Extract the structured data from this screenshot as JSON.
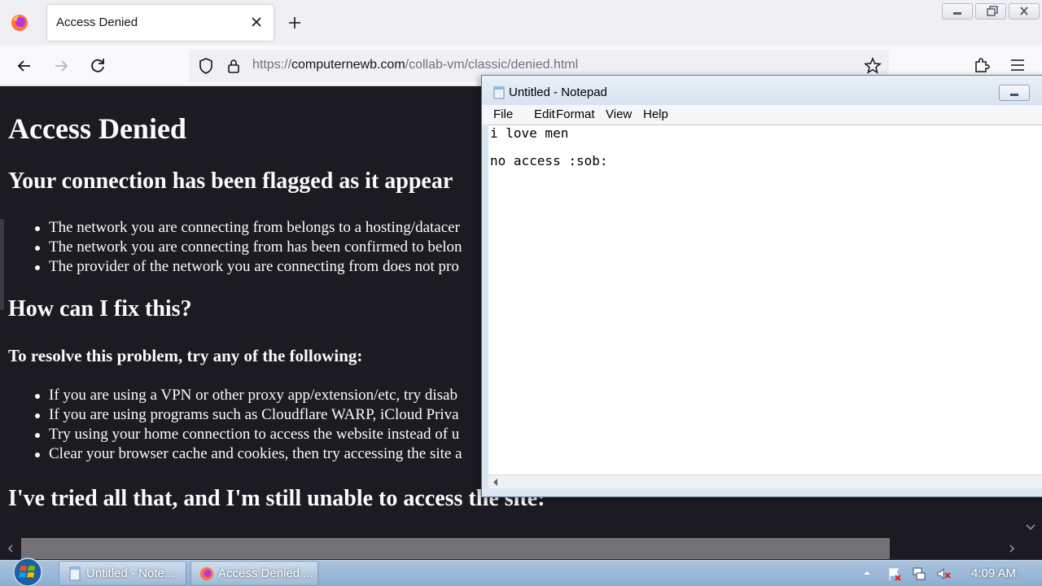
{
  "browser": {
    "tab_title": "Access Denied",
    "url_prefix": "https://",
    "url_host": "computernewb.com",
    "url_path": "/collab-vm/classic/denied.html"
  },
  "page": {
    "title": "Access Denied",
    "flag_heading": "Your connection has been flagged as it appear",
    "reasons": [
      "The network you are connecting from belongs to a hosting/datacer",
      "The network you are connecting from has been confirmed to belon",
      "The provider of the network you are connecting from does not pro"
    ],
    "fix_heading": "How can I fix this?",
    "resolve_heading": "To resolve this problem, try any of the following:",
    "fixes": [
      "If you are using a VPN or other proxy app/extension/etc, try disab",
      "If you are using programs such as Cloudflare WARP, iCloud Priva",
      "Try using your home connection to access the website instead of u",
      "Clear your browser cache and cookies, then try accessing the site a"
    ],
    "still_heading": "I've tried all that, and I'm still unable to access the site:"
  },
  "notepad": {
    "title": "Untitled - Notepad",
    "menu": [
      "File",
      "Edit",
      "Format",
      "View",
      "Help"
    ],
    "content": "i love men\n\nno access :sob:"
  },
  "taskbar": {
    "items": [
      {
        "label": "Untitled - Note..."
      },
      {
        "label": "Access Denied ..."
      }
    ],
    "clock": "4:09 AM"
  },
  "colors": {
    "page_background": "#1c1b22",
    "page_text": "#fbfbfe",
    "firefox_toolbar": "#f9f9fb",
    "taskbar": "#8eaed0"
  }
}
